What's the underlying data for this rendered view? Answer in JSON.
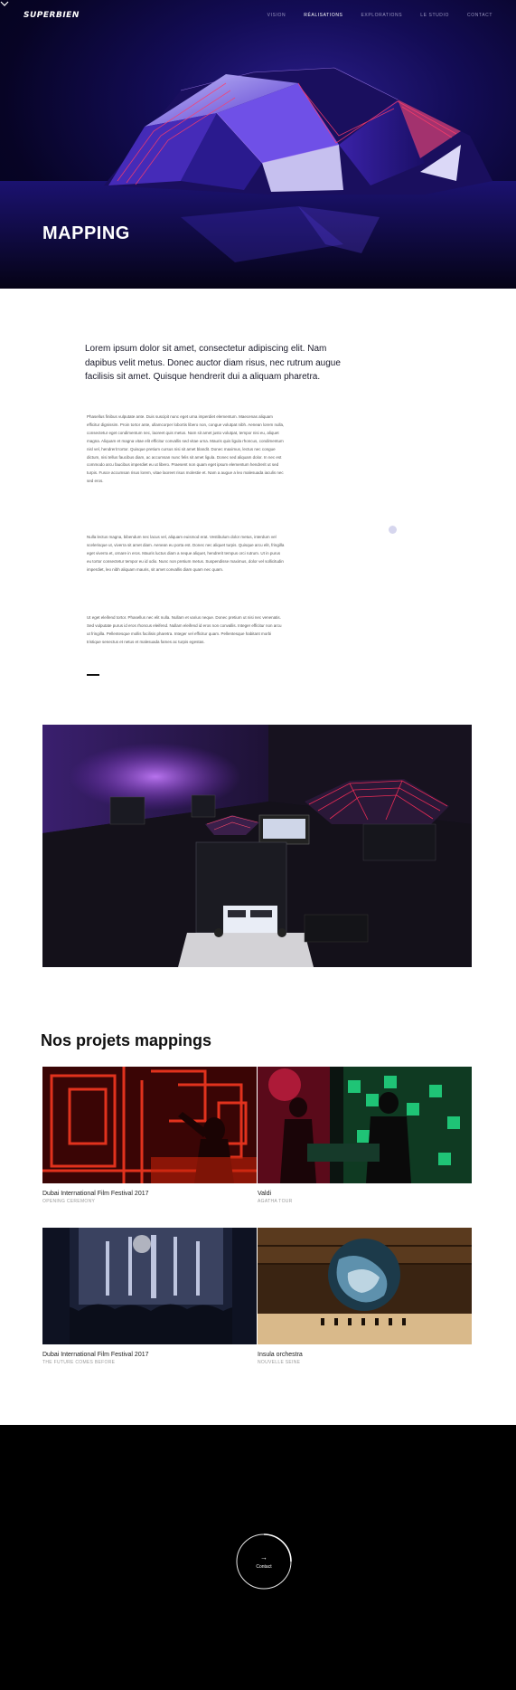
{
  "brand": {
    "logo_text": "SUPERBIEN"
  },
  "nav": {
    "items": [
      {
        "label": "VISION",
        "active": false
      },
      {
        "label": "RÉALISATIONS",
        "active": true
      },
      {
        "label": "EXPLORATIONS",
        "active": false
      },
      {
        "label": "LE STUDIO",
        "active": false
      },
      {
        "label": "CONTACT",
        "active": false
      }
    ]
  },
  "hero": {
    "title": "MAPPING",
    "scroll_icon": "chevron-down-icon"
  },
  "intro": {
    "lead": "Lorem ipsum dolor sit amet, consectetur adipiscing elit. Nam dapibus velit metus. Donec auctor diam risus, nec rutrum augue facilisis sit amet. Quisque hendrerit dui a aliquam pharetra.",
    "paragraphs": [
      "Phasellus finibus vulputate ante. Duis suscipit nunc eget urna imperdiet elementum. Maecenas aliquam efficitur dignissim. Proin tortor ante, ullamcorper lobortis libero non, congue volutpat nibh. Aenean lorem nulla, consectetur eget condimentum nec, laoreet quis metus. Nam sit amet justo volutpat, tempor nisi eu, aliquet magna. Aliquam et magna vitae elit efficitur convallis sed vitae urna. Mauris quis ligula rhoncus, condimentum nisl vel, hendrerit tortor. Quisque pretium cursus nisi sit amet blandit. Donec maximus, lectus nec congue dictum, nisi tellus faucibus diam, ac accumsan nunc felis sit amet ligula. Donec sed aliquam dolor. In nec est commodo arcu faucibus imperdiet eu ut libero. Praesent non quam eget ipsum elementum hendrerit ut sed turpis. Fusce accumsan risus lorem, vitae laoreet risus molestie et. Nam a augue a leo malesuada iaculis nec sed eros.",
      "Nulla lectus magna, bibendum nec lacus vel, aliquam euismod erat. Vestibulum dolor metus, interdum vel scelerisque ut, viverra sit amet diam. Aenean eu porta est. Donec nec aliquet turpis. Quisque arcu elit, fringilla eget viverra et, ornare in eros. Mauris luctus diam a neque aliquet, hendrerit tempus orci rutrum. Ut in purus eu tortor consectetur tempor eu id odio. Nunc non pretium metus. Suspendisse maximus, dolor vel sollicitudin imperdiet, leo nibh aliquam mauris, sit amet convallis diam quam nec quam.",
      "Ut eget eleifend tortor. Phasellus nec elit nulla. Nullam et varius neque. Donec pretium ut nisi nec venenatis. Sed vulputate purus id eros rhoncus eleifend. Nullam eleifend id eros non convallis. Integer efficitur non arcu ut fringilla. Pellentesque mollis facilisis pharetra. Integer vel efficitur quam. Pellentesque habitant morbi tristique senectus et netus et malesuada fames ac turpis egestas."
    ]
  },
  "projects": {
    "title": "Nos projets mappings",
    "items": [
      {
        "title": "Dubai International  Film Festival 2017",
        "subtitle": "OPENING CEREMONY"
      },
      {
        "title": "Valdi",
        "subtitle": "AGATHA TOUR"
      },
      {
        "title": "Dubai International  Film Festival 2017",
        "subtitle": "THE FUTURE COMES BEFORE"
      },
      {
        "title": "Insula orchestra",
        "subtitle": "NOUVELLE SEINE"
      }
    ]
  },
  "footer": {
    "contact_label": "Contact",
    "contact_arrow": "→"
  },
  "colors": {
    "hero_bg": "#070425",
    "accent_purple": "#7b3cff",
    "accent_red": "#ff2a4a",
    "footer_bg": "#000000"
  }
}
